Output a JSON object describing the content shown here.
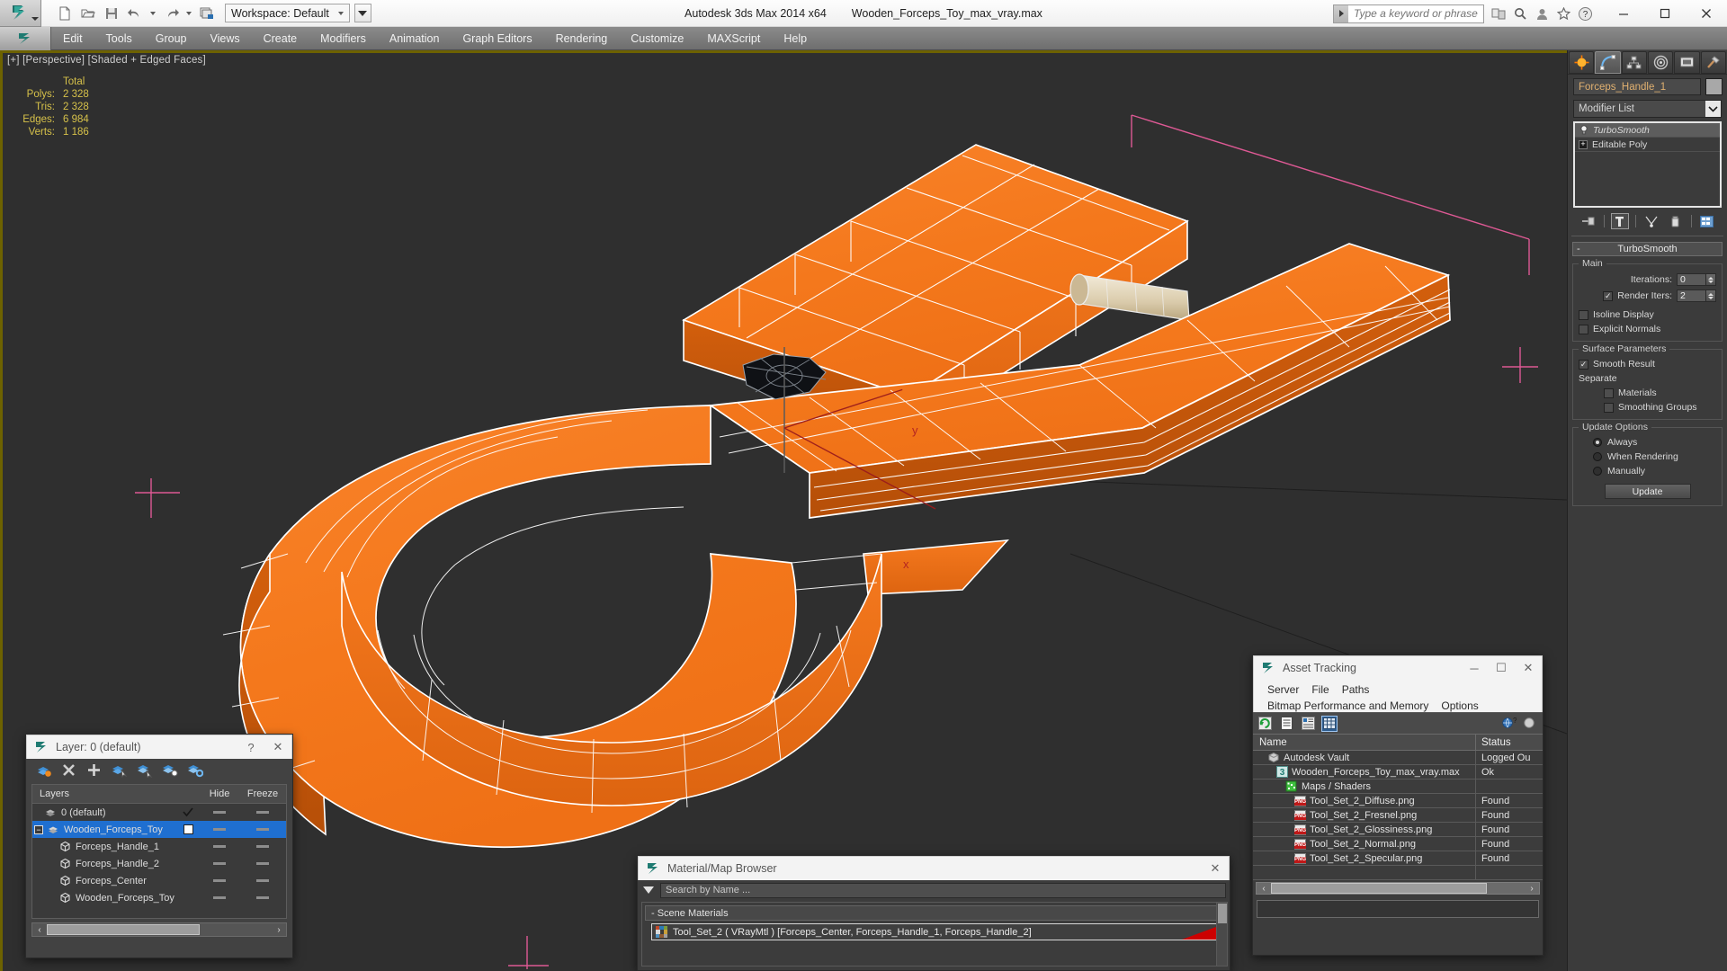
{
  "title_bar": {
    "app_title": "Autodesk 3ds Max  2014 x64",
    "file_name": "Wooden_Forceps_Toy_max_vray.max",
    "workspace_label": "Workspace: Default",
    "search_placeholder": "Type a keyword or phrase",
    "quick_access": [
      {
        "name": "new-file",
        "icon": "document-icon"
      },
      {
        "name": "open-file",
        "icon": "folder-open-icon"
      },
      {
        "name": "save-file",
        "icon": "floppy-disk-icon"
      },
      {
        "name": "undo",
        "icon": "undo-arrow-icon"
      },
      {
        "name": "redo",
        "icon": "redo-arrow-icon"
      },
      {
        "name": "project-folder",
        "icon": "project-folder-icon"
      }
    ],
    "window_controls": {
      "minimize": "─",
      "maximize": "☐",
      "close": "✕"
    }
  },
  "menu_bar": {
    "items": [
      "Edit",
      "Tools",
      "Group",
      "Views",
      "Create",
      "Modifiers",
      "Animation",
      "Graph Editors",
      "Rendering",
      "Customize",
      "MAXScript",
      "Help"
    ]
  },
  "viewport": {
    "label": "[+] [Perspective] [Shaded + Edged Faces]",
    "stats": {
      "header": "Total",
      "rows": [
        {
          "key": "Polys:",
          "value": "2 328"
        },
        {
          "key": "Tris:",
          "value": "2 328"
        },
        {
          "key": "Edges:",
          "value": "6 984"
        },
        {
          "key": "Verts:",
          "value": "1 186"
        }
      ]
    },
    "colors": {
      "background": "#2f2f2f",
      "model_orange": "#f57c20",
      "model_orange_dark": "#c2550c",
      "wireframe": "#ffffff",
      "grid_pink": "#e85c9a",
      "axis_red": "#a01818",
      "stats_text": "#d6c14a",
      "active_border": "#6d6200"
    },
    "axis_labels": {
      "y": "y",
      "x": "x"
    }
  },
  "command_panel": {
    "tabs": [
      {
        "name": "create-tab",
        "icon": "star-burst-icon"
      },
      {
        "name": "modify-tab",
        "icon": "curve-arc-icon",
        "active": true
      },
      {
        "name": "hierarchy-tab",
        "icon": "hierarchy-tree-icon"
      },
      {
        "name": "motion-tab",
        "icon": "motion-wheel-icon"
      },
      {
        "name": "display-tab",
        "icon": "monitor-icon"
      },
      {
        "name": "utilities-tab",
        "icon": "hammer-icon"
      }
    ],
    "object_name": "Forceps_Handle_1",
    "modifier_list_label": "Modifier List",
    "modifier_stack": [
      {
        "label": "TurboSmooth",
        "selected": true,
        "italic": true,
        "icon": "lightbulb-icon"
      },
      {
        "label": "Editable Poly",
        "selected": false,
        "italic": false,
        "icon": "plus-box-icon"
      }
    ],
    "stack_tools": [
      {
        "name": "pin-stack-button",
        "icon": "pin-stack-icon"
      },
      {
        "name": "show-end-result-button",
        "icon": "show-end-result-icon"
      },
      {
        "name": "make-unique-button",
        "icon": "make-unique-icon"
      },
      {
        "name": "remove-modifier-button",
        "icon": "trash-icon"
      },
      {
        "name": "configure-modifier-sets-button",
        "icon": "config-sets-icon"
      }
    ],
    "rollout": {
      "title": "TurboSmooth",
      "collapse_sign": "-",
      "groups": [
        {
          "label": "Main",
          "fields": [
            {
              "type": "spinner",
              "label": "Iterations:",
              "value": "0"
            },
            {
              "type": "spinner-checkbox",
              "label": "Render Iters:",
              "value": "2",
              "checked": true
            },
            {
              "type": "checkbox",
              "label": "Isoline Display",
              "checked": false
            },
            {
              "type": "checkbox",
              "label": "Explicit Normals",
              "checked": false
            }
          ]
        },
        {
          "label": "Surface Parameters",
          "fields": [
            {
              "type": "checkbox",
              "label": "Smooth Result",
              "checked": true
            },
            {
              "type": "text",
              "label": "Separate"
            },
            {
              "type": "checkbox",
              "label": "Materials",
              "checked": false
            },
            {
              "type": "checkbox",
              "label": "Smoothing Groups",
              "checked": false
            }
          ]
        },
        {
          "label": "Update Options",
          "fields": [
            {
              "type": "radio",
              "label": "Always",
              "checked": true
            },
            {
              "type": "radio",
              "label": "When Rendering",
              "checked": false
            },
            {
              "type": "radio",
              "label": "Manually",
              "checked": false
            },
            {
              "type": "button",
              "label": "Update"
            }
          ]
        }
      ]
    }
  },
  "layer_dialog": {
    "title": "Layer: 0 (default)",
    "help_btn": "?",
    "close_btn": "✕",
    "toolbar": [
      {
        "name": "create-new-layer-button",
        "icon": "new-layer-icon"
      },
      {
        "name": "delete-layer-button",
        "icon": "delete-x-icon"
      },
      {
        "name": "add-selection-button",
        "icon": "plus-icon"
      },
      {
        "name": "select-objects-in-layer-button",
        "icon": "select-layer-objects-icon"
      },
      {
        "name": "select-highlighted-layers-button",
        "icon": "select-highlighted-icon"
      },
      {
        "name": "highlight-selected-objects-layer-button",
        "icon": "highlight-selected-icon"
      },
      {
        "name": "layer-properties-button",
        "icon": "layer-properties-icon"
      }
    ],
    "columns": [
      "Layers",
      "",
      "Hide",
      "Freeze"
    ],
    "rows": [
      {
        "label": "0 (default)",
        "indent": 0,
        "icon": "layer-stack-icon",
        "current": true,
        "selected": false,
        "expander": "",
        "hide": "-",
        "freeze": "-"
      },
      {
        "label": "Wooden_Forceps_Toy",
        "indent": 0,
        "icon": "layer-stack-icon",
        "current": false,
        "selected": true,
        "expander": "-",
        "hide": "-",
        "freeze": "-"
      },
      {
        "label": "Forceps_Handle_1",
        "indent": 1,
        "icon": "object-box-icon",
        "current": false,
        "selected": false,
        "expander": "",
        "hide": "-",
        "freeze": "-"
      },
      {
        "label": "Forceps_Handle_2",
        "indent": 1,
        "icon": "object-box-icon",
        "current": false,
        "selected": false,
        "expander": "",
        "hide": "-",
        "freeze": "-"
      },
      {
        "label": "Forceps_Center",
        "indent": 1,
        "icon": "object-box-icon",
        "current": false,
        "selected": false,
        "expander": "",
        "hide": "-",
        "freeze": "-"
      },
      {
        "label": "Wooden_Forceps_Toy",
        "indent": 1,
        "icon": "object-box-icon",
        "current": false,
        "selected": false,
        "expander": "",
        "hide": "-",
        "freeze": "-"
      }
    ]
  },
  "material_browser": {
    "title": "Material/Map Browser",
    "close_btn": "✕",
    "search_placeholder": "Search by Name ...",
    "group_label": "- Scene Materials",
    "items": [
      {
        "label": "Tool_Set_2  ( VRayMtl )  [Forceps_Center, Forceps_Handle_1, Forceps_Handle_2]",
        "flag_color": "#cc0000"
      }
    ]
  },
  "asset_tracking": {
    "title": "Asset Tracking",
    "window_controls": {
      "minimize": "─",
      "maximize": "☐",
      "close": "✕"
    },
    "menus": [
      "Server",
      "File",
      "Paths",
      "Bitmap Performance and Memory",
      "Options"
    ],
    "toolbar": [
      {
        "name": "refresh-button",
        "icon": "refresh-icon"
      },
      {
        "name": "list-view-button",
        "icon": "list-icon"
      },
      {
        "name": "detail-view-button",
        "icon": "detail-icon"
      },
      {
        "name": "grid-view-button",
        "icon": "grid-icon",
        "selected": true
      },
      {
        "name": "help-vault-button",
        "icon": "help-globe-icon"
      },
      {
        "name": "help-button",
        "icon": "help-question-icon"
      }
    ],
    "columns": [
      "Name",
      "Status"
    ],
    "rows": [
      {
        "name": "Autodesk Vault",
        "status": "Logged Ou",
        "indent": 1,
        "icon": "vault-icon"
      },
      {
        "name": "Wooden_Forceps_Toy_max_vray.max",
        "status": "Ok",
        "indent": 2,
        "icon": "max-file-icon"
      },
      {
        "name": "Maps / Shaders",
        "status": "",
        "indent": 3,
        "icon": "maps-shaders-icon"
      },
      {
        "name": "Tool_Set_2_Diffuse.png",
        "status": "Found",
        "indent": 4,
        "icon": "png-icon"
      },
      {
        "name": "Tool_Set_2_Fresnel.png",
        "status": "Found",
        "indent": 4,
        "icon": "png-icon"
      },
      {
        "name": "Tool_Set_2_Glossiness.png",
        "status": "Found",
        "indent": 4,
        "icon": "png-icon"
      },
      {
        "name": "Tool_Set_2_Normal.png",
        "status": "Found",
        "indent": 4,
        "icon": "png-icon"
      },
      {
        "name": "Tool_Set_2_Specular.png",
        "status": "Found",
        "indent": 4,
        "icon": "png-icon"
      }
    ]
  }
}
